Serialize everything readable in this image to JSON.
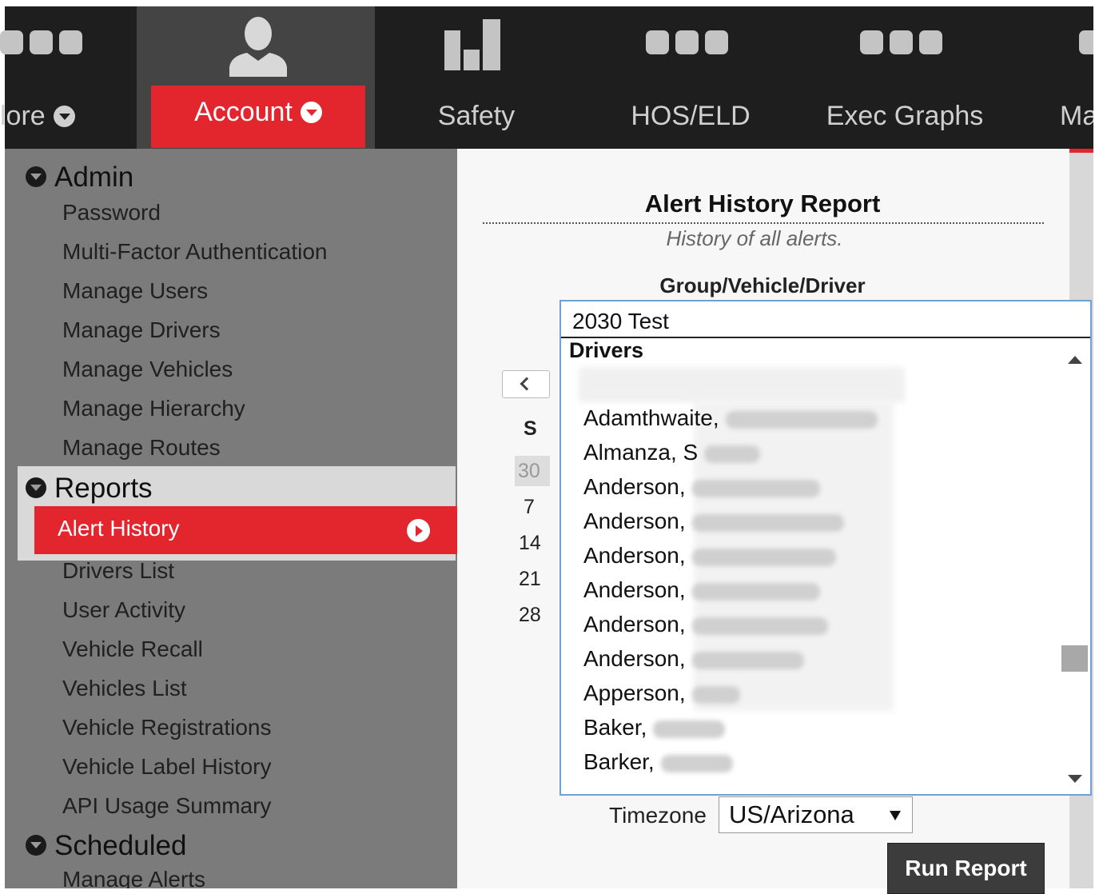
{
  "nav": {
    "more_label": "lore",
    "account_label": "Account",
    "safety_label": "Safety",
    "hos_label": "HOS/ELD",
    "exec_label": "Exec Graphs",
    "map_label": "Ma"
  },
  "menu": {
    "admin": {
      "title": "Admin",
      "items": [
        "Password",
        "Multi-Factor Authentication",
        "Manage Users",
        "Manage Drivers",
        "Manage Vehicles",
        "Manage Hierarchy",
        "Manage Routes"
      ]
    },
    "reports": {
      "title": "Reports",
      "active": "Alert History",
      "items": [
        "Drivers List",
        "User Activity",
        "Vehicle Recall",
        "Vehicles List",
        "Vehicle Registrations",
        "Vehicle Label History",
        "API Usage Summary"
      ]
    },
    "scheduled": {
      "title": "Scheduled",
      "items": [
        "Manage Alerts"
      ]
    }
  },
  "report": {
    "title": "Alert History Report",
    "subtitle": "History of all alerts.",
    "group_label": "Group/Vehicle/Driver",
    "calendar": {
      "day_header": "S",
      "days": [
        "30",
        "7",
        "14",
        "21",
        "28"
      ]
    },
    "timezone_label": "Timezone",
    "timezone_value": "US/Arizona",
    "run_button": "Run Report"
  },
  "dropdown": {
    "input_value": "2030 Test",
    "group": "Drivers",
    "options": [
      "Adamthwaite,",
      "Almanza, S",
      "Anderson,",
      "Anderson,",
      "Anderson,",
      "Anderson,",
      "Anderson,",
      "Anderson,",
      "Apperson,",
      "Baker,",
      "Barker,"
    ]
  },
  "colors": {
    "brand_red": "#e3262d",
    "nav_bg": "#1e1e1e",
    "menu_bg": "#7b7b7b"
  }
}
